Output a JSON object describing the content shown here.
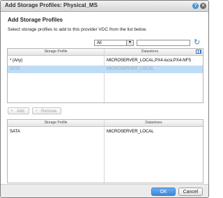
{
  "dialog": {
    "title": "Add Storage Profiles: Physical_MS",
    "help_glyph": "?",
    "close_glyph": "✕"
  },
  "section_title": "Add Storage Profiles",
  "instruction": "Select storage profiles to add to this provider VDC from the list below.",
  "filter": {
    "selected": "All",
    "search_value": ""
  },
  "available_grid": {
    "headers": [
      "Storage Profile",
      "Datastores"
    ],
    "rows": [
      {
        "profile": "* (Any)",
        "datastores": "MICROSERVER_LOCAL,PX4-iscsi,PX4-NFS",
        "selected": false
      },
      {
        "profile": "SATA",
        "datastores": "MICROSERVER_LOCAL",
        "selected": true
      }
    ]
  },
  "buttons": {
    "add": "Add",
    "remove": "Remove",
    "add_icon_glyph": "+",
    "remove_icon_glyph": "−",
    "ok": "OK",
    "cancel": "Cancel"
  },
  "selected_grid": {
    "headers": [
      "Storage Profile",
      "Datastores"
    ],
    "rows": [
      {
        "profile": "SATA",
        "datastores": "MICROSERVER_LOCAL"
      }
    ]
  },
  "colors": {
    "accent": "#3f86d8",
    "selected_row": "#bfdcf5"
  }
}
